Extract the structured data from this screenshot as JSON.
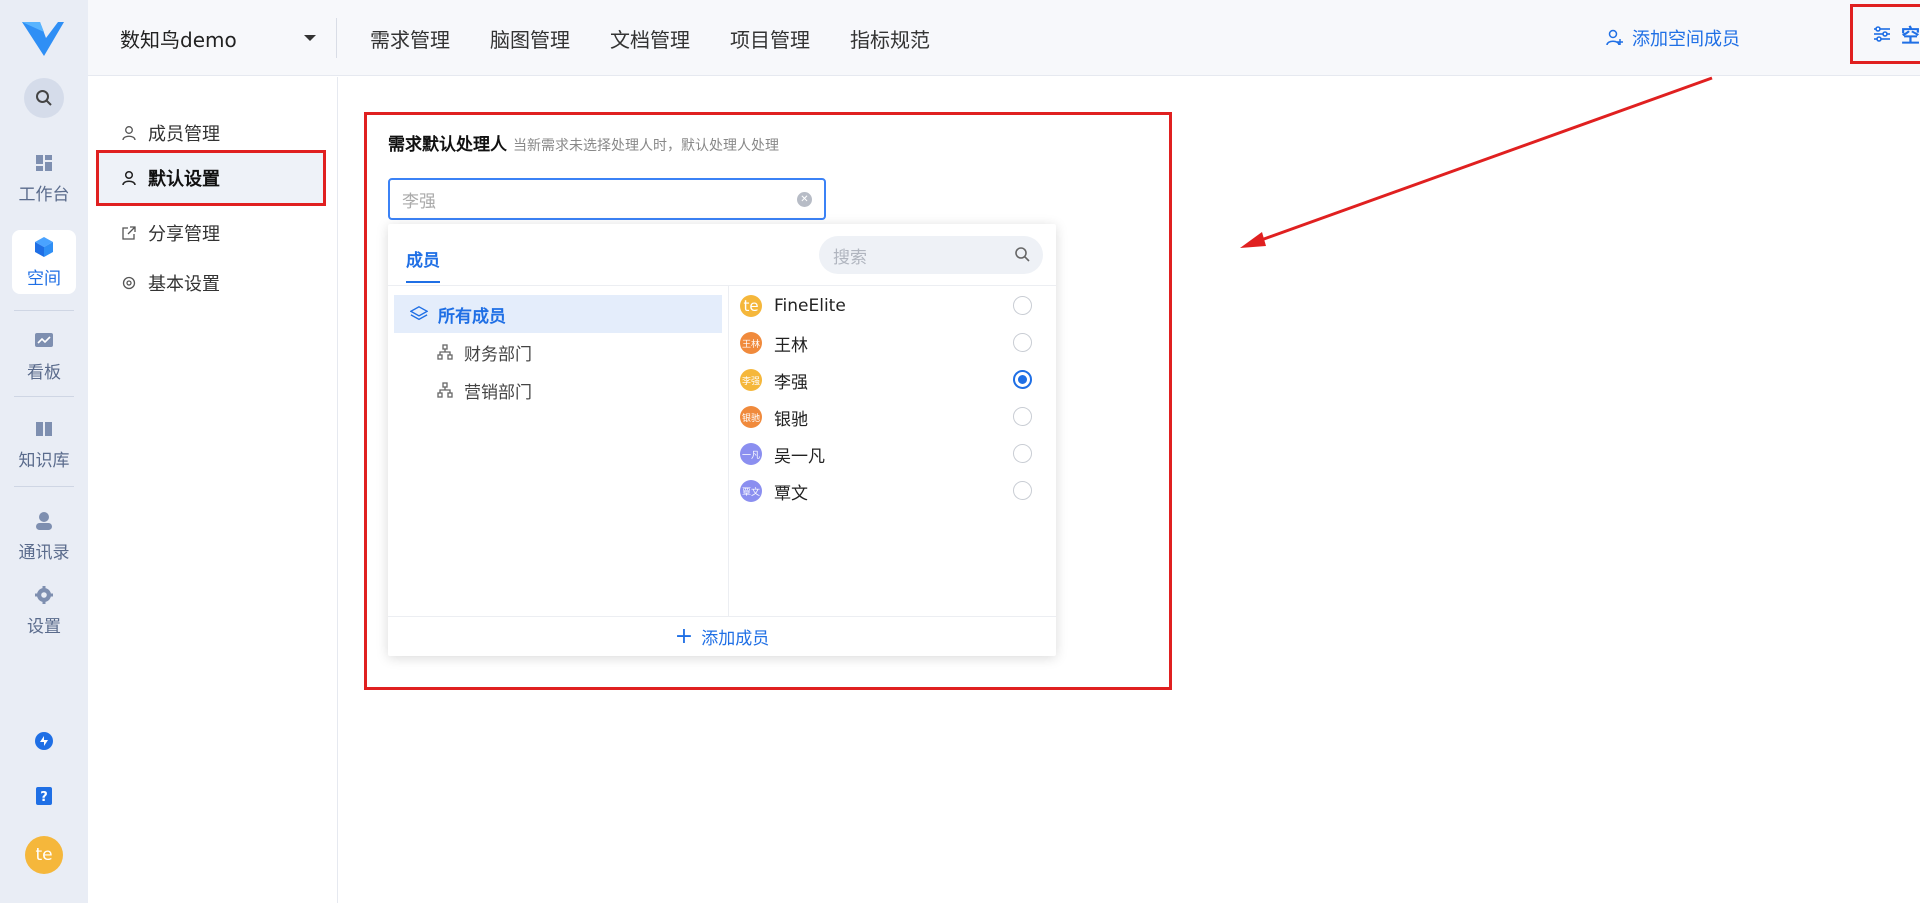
{
  "rail": {
    "items": [
      {
        "label": "工作台",
        "icon": "dashboard-icon"
      },
      {
        "label": "空间",
        "icon": "cube-icon",
        "active": true
      },
      {
        "label": "看板",
        "icon": "chart-board-icon"
      },
      {
        "label": "知识库",
        "icon": "book-icon"
      },
      {
        "label": "通讯录",
        "icon": "contact-icon"
      },
      {
        "label": "设置",
        "icon": "gear-icon"
      }
    ],
    "avatar_text": "te"
  },
  "header": {
    "workspace": "数知鸟demo",
    "nav": [
      "需求管理",
      "脑图管理",
      "文档管理",
      "项目管理",
      "指标规范"
    ],
    "add_member": "添加空间成员",
    "space_settings": "空间设置"
  },
  "sidebar": {
    "items": [
      {
        "label": "成员管理",
        "icon": "user-icon"
      },
      {
        "label": "默认设置",
        "icon": "user-icon",
        "active": true
      },
      {
        "label": "分享管理",
        "icon": "share-icon"
      },
      {
        "label": "基本设置",
        "icon": "gear-icon"
      }
    ]
  },
  "section": {
    "title": "需求默认处理人",
    "desc": "当新需求未选择处理人时，默认处理人处理",
    "input_placeholder": "李强"
  },
  "dropdown": {
    "tab": "成员",
    "search_placeholder": "搜索",
    "departments": [
      "所有成员",
      "财务部门",
      "营销部门"
    ],
    "members": [
      {
        "name": "FineElite",
        "avatar": "te",
        "color": "#f5b73b",
        "selected": false
      },
      {
        "name": "王林",
        "avatar": "王林",
        "color": "#f08a3c",
        "selected": false
      },
      {
        "name": "李强",
        "avatar": "李强",
        "color": "#f5b73b",
        "selected": true
      },
      {
        "name": "银驰",
        "avatar": "银驰",
        "color": "#f08a3c",
        "selected": false
      },
      {
        "name": "吴一凡",
        "avatar": "一凡",
        "color": "#8b8ff0",
        "selected": false
      },
      {
        "name": "覃文",
        "avatar": "覃文",
        "color": "#8b8ff0",
        "selected": false
      }
    ],
    "footer": "添加成员"
  },
  "colors": {
    "accent": "#1f6fe5",
    "highlight": "#e02020"
  }
}
